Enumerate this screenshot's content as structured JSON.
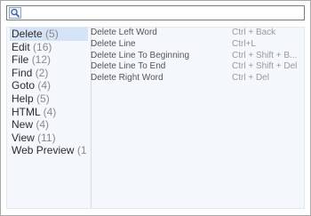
{
  "search": {
    "value": "",
    "placeholder": ""
  },
  "categories": [
    {
      "name": "Delete",
      "count": "(5)"
    },
    {
      "name": "Edit",
      "count": "(16)"
    },
    {
      "name": "File",
      "count": "(12)"
    },
    {
      "name": "Find",
      "count": "(2)"
    },
    {
      "name": "Goto",
      "count": "(4)"
    },
    {
      "name": "Help",
      "count": "(5)"
    },
    {
      "name": "HTML",
      "count": "(4)"
    },
    {
      "name": "New",
      "count": "(4)"
    },
    {
      "name": "View",
      "count": "(11)"
    },
    {
      "name": "Web Preview",
      "count": "(1"
    }
  ],
  "commands": [
    {
      "name": "Delete Left Word",
      "shortcut": "Ctrl + Back"
    },
    {
      "name": "Delete Line",
      "shortcut": "Ctrl+L"
    },
    {
      "name": "Delete Line To Beginning",
      "shortcut": "Ctrl + Shift + B..."
    },
    {
      "name": "Delete Line To End",
      "shortcut": "Ctrl + Shift + Del"
    },
    {
      "name": "Delete Right Word",
      "shortcut": "Ctrl + Del"
    }
  ],
  "colors": {
    "selection": "#d5e3f7",
    "panel_background": "#f4f7fb"
  }
}
